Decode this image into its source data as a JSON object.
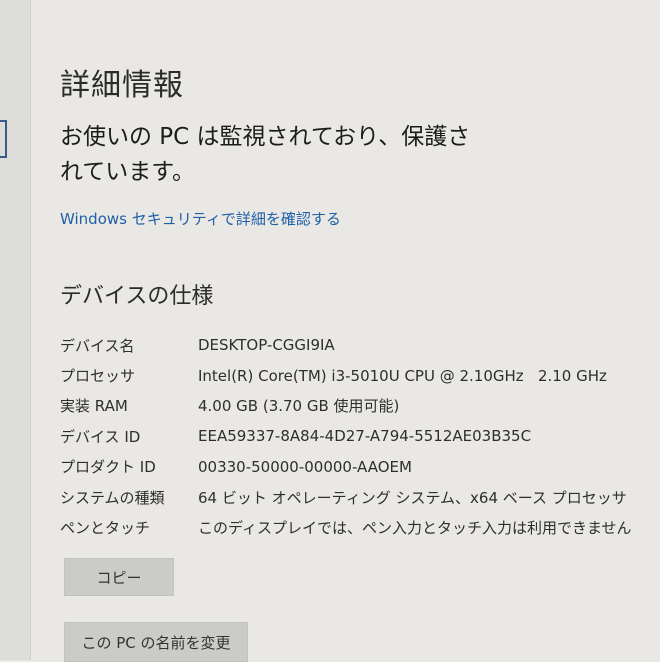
{
  "page_title": "詳細情報",
  "protection_text": "お使いの PC は監視されており、保護されています。",
  "security_link": "Windows セキュリティで詳細を確認する",
  "device_specs": {
    "title": "デバイスの仕様",
    "rows": [
      {
        "label": "デバイス名",
        "value": "DESKTOP-CGGI9IA"
      },
      {
        "label": "プロセッサ",
        "value": "Intel(R) Core(TM) i3-5010U CPU @ 2.10GHz   2.10 GHz"
      },
      {
        "label": "実装 RAM",
        "value": "4.00 GB (3.70 GB 使用可能)"
      },
      {
        "label": "デバイス ID",
        "value": "EEA59337-8A84-4D27-A794-5512AE03B35C"
      },
      {
        "label": "プロダクト ID",
        "value": "00330-50000-00000-AAOEM"
      },
      {
        "label": "システムの種類",
        "value": "64 ビット オペレーティング システム、x64 ベース プロセッサ"
      },
      {
        "label": "ペンとタッチ",
        "value": "このディスプレイでは、ペン入力とタッチ入力は利用できません"
      }
    ]
  },
  "buttons": {
    "copy": "コピー",
    "rename": "この PC の名前を変更"
  }
}
